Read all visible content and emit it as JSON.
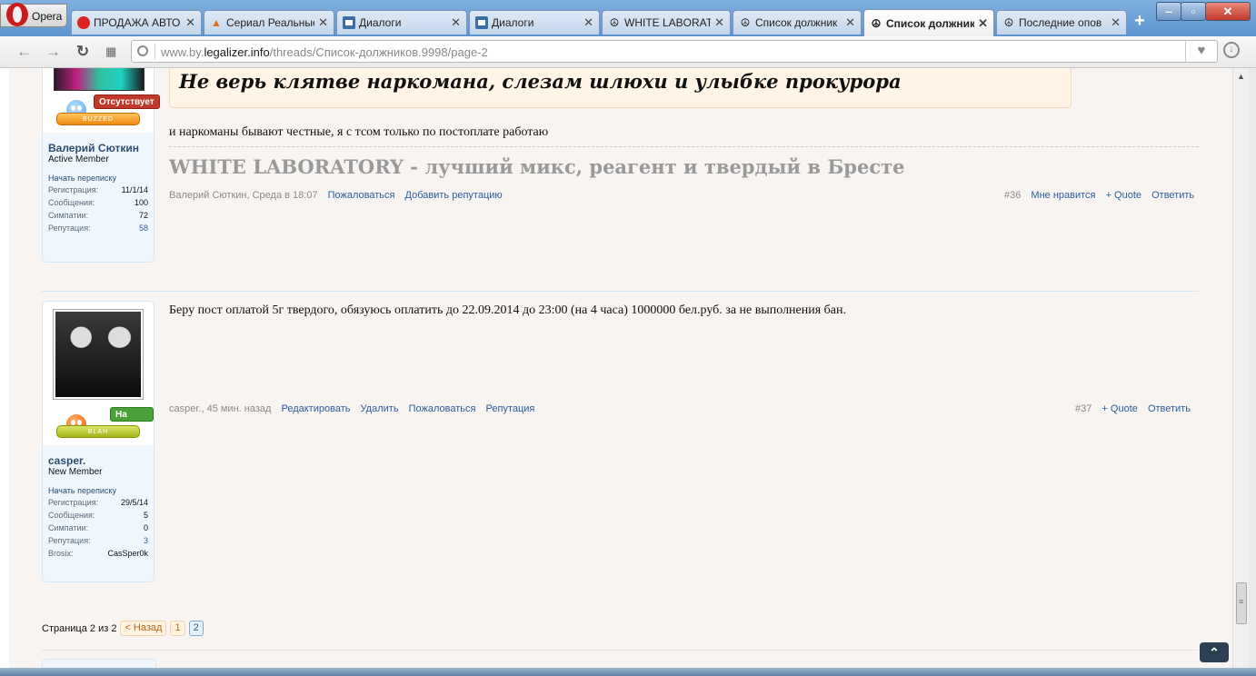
{
  "browser": {
    "menu_label": "Opera",
    "tabs": [
      {
        "title": "ПРОДАЖА АВТО",
        "icon": "car-icon"
      },
      {
        "title": "Сериал Реальные",
        "icon": "flame-icon"
      },
      {
        "title": "Диалоги",
        "icon": "chat-icon"
      },
      {
        "title": "Диалоги",
        "icon": "chat-icon"
      },
      {
        "title": "WHITE LABORAT",
        "icon": "peace-icon"
      },
      {
        "title": "Список должник",
        "icon": "peace-icon"
      },
      {
        "title": "Список должник",
        "icon": "peace-icon",
        "active": true
      },
      {
        "title": "Последние опов",
        "icon": "peace-icon"
      }
    ],
    "new_tab": "+",
    "url_prefix": "www.by.",
    "url_host": "legalizer.info",
    "url_path": "/threads/Список-должников.9998/page-2"
  },
  "posts": [
    {
      "user": {
        "name": "Валерий Сюткин",
        "title": "Active Member",
        "status": "Отсутствует",
        "mood": "BUZZED",
        "start_conversation": "Начать переписку",
        "stats": [
          {
            "key": "Регистрация:",
            "value": "11/1/14"
          },
          {
            "key": "Сообщения:",
            "value": "100"
          },
          {
            "key": "Симпатии:",
            "value": "72"
          },
          {
            "key": "Репутация:",
            "value": "58"
          }
        ]
      },
      "quote": "Не верь клятве наркомана, слезам шлюхи и улыбке прокурора",
      "text": "и наркоманы бывают честные, я с тсом только по постоплате работаю",
      "signature": "WHITE LABORATORY - лучший микс, реагент и твердый в Бресте",
      "meta": {
        "author": "Валерий Сюткин",
        "time": ", Среда в 18:07",
        "actions": [
          "Пожаловаться",
          "Добавить репутацию"
        ],
        "number": "#36",
        "right_actions": [
          "Мне нравится",
          "+ Quote",
          "Ответить"
        ]
      }
    },
    {
      "user": {
        "name": "casper.",
        "title": "New Member",
        "status": "На сайте",
        "mood": "BLAH",
        "start_conversation": "Начать переписку",
        "stats": [
          {
            "key": "Регистрация:",
            "value": "29/5/14"
          },
          {
            "key": "Сообщения:",
            "value": "5"
          },
          {
            "key": "Симпатии:",
            "value": "0"
          },
          {
            "key": "Репутация:",
            "value": "3"
          },
          {
            "key": "Brosix:",
            "value": "CasSper0k"
          }
        ]
      },
      "text": "Беру пост оплатой 5г твердого, обязуюсь оплатить до 22.09.2014 до 23:00 (на 4 часа) 1000000 бел.руб. за не выполнения бан.",
      "meta": {
        "author": "casper.",
        "time": ", 45 мин. назад",
        "actions": [
          "Редактировать",
          "Удалить",
          "Пожаловаться",
          "Репутация"
        ],
        "number": "#37",
        "right_actions": [
          "+ Quote",
          "Ответить"
        ]
      }
    }
  ],
  "pagination": {
    "label": "Страница 2 из 2",
    "prev": "< Назад",
    "pages": [
      "1",
      "2"
    ],
    "current": "2"
  }
}
